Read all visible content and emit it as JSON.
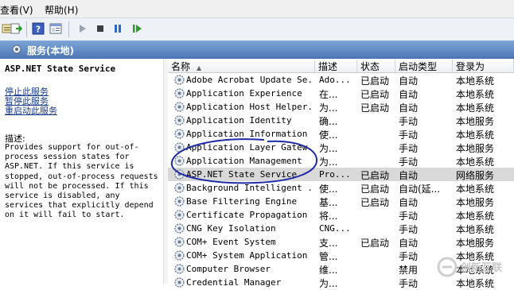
{
  "menu": {
    "view": "查看(V)",
    "help": "帮助(H)"
  },
  "header": {
    "title": "服务(本地)"
  },
  "left_panel": {
    "service_name": "ASP.NET State Service",
    "links": [
      "停止此服务",
      "暂停此服务",
      "重启动此服务"
    ],
    "description_label": "描述:",
    "description": "Provides support for out-of-\nprocess session states for\nASP.NET. If this service is\nstopped, out-of-process requests\nwill not be processed. If this\nservice is disabled, any\nservices that explicitly depend\non it will fail to start."
  },
  "columns": {
    "name": "名称",
    "description": "描述",
    "status": "状态",
    "startup": "启动类型",
    "logon": "登录为"
  },
  "rows": [
    {
      "name": "Adobe Acrobat Update Se...",
      "desc": "Ado...",
      "status": "已启动",
      "startup": "自动",
      "logon": "本地系统"
    },
    {
      "name": "Application Experience",
      "desc": "在...",
      "status": "已启动",
      "startup": "自动",
      "logon": "本地系统"
    },
    {
      "name": "Application Host Helper...",
      "desc": "为...",
      "status": "已启动",
      "startup": "自动",
      "logon": "本地系统"
    },
    {
      "name": "Application Identity",
      "desc": "确...",
      "status": "",
      "startup": "手动",
      "logon": "本地服务"
    },
    {
      "name": "Application Information",
      "desc": "使...",
      "status": "",
      "startup": "手动",
      "logon": "本地系统"
    },
    {
      "name": "Application Layer Gatew...",
      "desc": "为...",
      "status": "",
      "startup": "手动",
      "logon": "本地服务"
    },
    {
      "name": "Application Management",
      "desc": "为...",
      "status": "",
      "startup": "手动",
      "logon": "本地系统"
    },
    {
      "name": "ASP.NET State Service",
      "desc": "Pro...",
      "status": "已启动",
      "startup": "自动",
      "logon": "网络服务"
    },
    {
      "name": "Background Intelligent ...",
      "desc": "使...",
      "status": "已启动",
      "startup": "自动(延...",
      "logon": "本地系统"
    },
    {
      "name": "Base Filtering Engine",
      "desc": "基...",
      "status": "已启动",
      "startup": "自动",
      "logon": "本地服务"
    },
    {
      "name": "Certificate Propagation",
      "desc": "将...",
      "status": "",
      "startup": "手动",
      "logon": "本地系统"
    },
    {
      "name": "CNG Key Isolation",
      "desc": "CNG...",
      "status": "",
      "startup": "手动",
      "logon": "本地系统"
    },
    {
      "name": "COM+ Event System",
      "desc": "支...",
      "status": "已启动",
      "startup": "自动",
      "logon": "本地服务"
    },
    {
      "name": "COM+ System Application",
      "desc": "管...",
      "status": "",
      "startup": "手动",
      "logon": "本地系统"
    },
    {
      "name": "Computer Browser",
      "desc": "维...",
      "status": "",
      "startup": "禁用",
      "logon": "本地系统"
    },
    {
      "name": "Credential Manager",
      "desc": "为...",
      "status": "",
      "startup": "手动",
      "logon": "本地系统"
    }
  ],
  "selected_index": 7,
  "watermark": {
    "text": "创新互联"
  },
  "colors": {
    "header_top": "#7fa6d8",
    "header_bottom": "#4b74b4",
    "annotation": "#1e2aa8",
    "link": "#1a3c8c"
  }
}
